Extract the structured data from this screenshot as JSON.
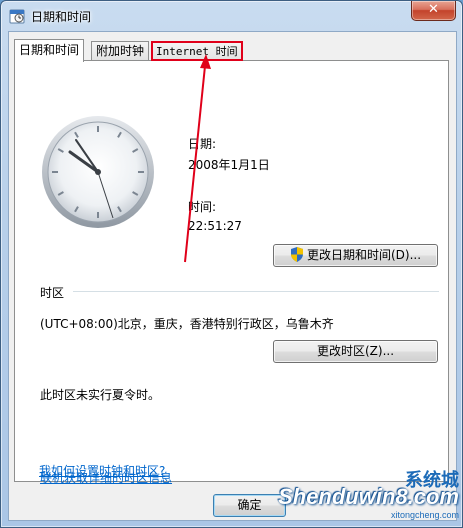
{
  "window": {
    "title": "日期和时间",
    "close_glyph": "✕"
  },
  "tabs": [
    {
      "label": "日期和时间"
    },
    {
      "label": "附加时钟"
    },
    {
      "label": "Internet 时间"
    }
  ],
  "datetime": {
    "date_label": "日期:",
    "date_value": "2008年1月1日",
    "time_label": "时间:",
    "time_value": "22:51:27",
    "change_button": "更改日期和时间(D)..."
  },
  "timezone": {
    "section_label": "时区",
    "value": "(UTC+08:00)北京，重庆，香港特别行政区，乌鲁木齐",
    "change_button": "更改时区(Z)...",
    "dst_note": "此时区未实行夏令时。"
  },
  "links": {
    "online_info": "联机获取详细的时区信息",
    "how_to": "我如何设置时钟和时区?"
  },
  "footer": {
    "ok_button": "确定"
  },
  "watermark": {
    "logo": "Shenduwin8.com",
    "cn": "系统城",
    "url": "xitongcheng.com"
  },
  "colors": {
    "highlight": "#e0001a",
    "link": "#0066cc"
  },
  "icons": {
    "title": "clock-calendar-icon",
    "shield": "uac-shield-icon"
  }
}
